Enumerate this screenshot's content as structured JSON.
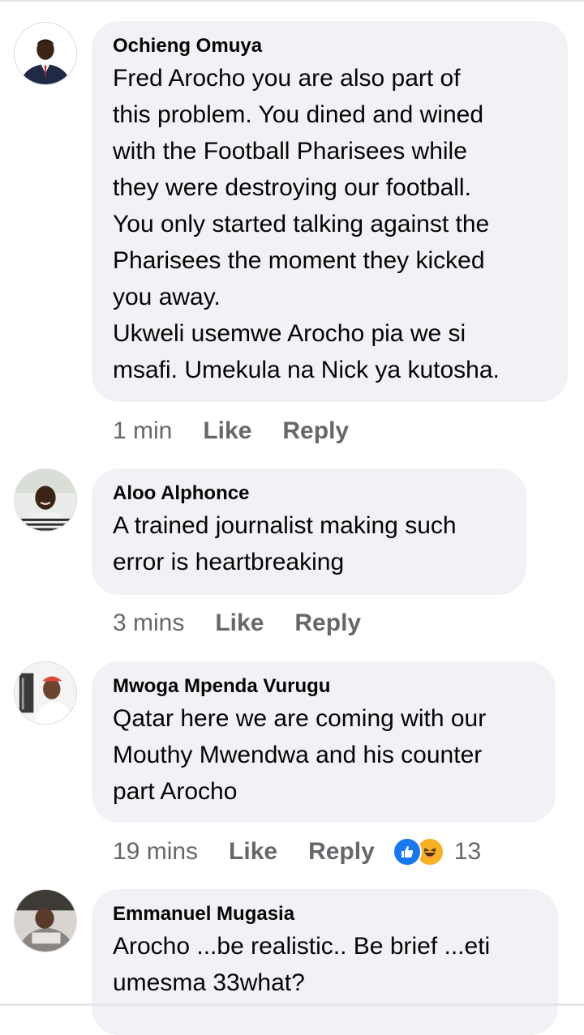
{
  "comments": [
    {
      "author": "Ochieng Omuya",
      "text": " Fred Arocho you are also part of\nthis problem. You dined and wined\nwith the Football Pharisees while\nthey were destroying our football.\nYou only started talking against the\nPharisees the moment they kicked\nyou away.\nUkweli usemwe Arocho pia we si\nmsafi. Umekula na Nick ya kutosha.",
      "time": "1 min",
      "like_label": "Like",
      "reply_label": "Reply"
    },
    {
      "author": "Aloo Alphonce",
      "text": "A trained journalist making such\nerror is heartbreaking",
      "time": "3 mins",
      "like_label": "Like",
      "reply_label": "Reply"
    },
    {
      "author": "Mwoga Mpenda Vurugu",
      "text": "Qatar here we are coming with our\nMouthy Mwendwa and his counter\npart Arocho",
      "time": "19 mins",
      "like_label": "Like",
      "reply_label": "Reply",
      "reaction_count": "13",
      "reactions": [
        "like-reaction-icon",
        "haha-reaction-icon"
      ]
    },
    {
      "author": "Emmanuel Mugasia",
      "text": "Arocho ...be realistic.. Be brief ...eti\numesma 33what?"
    }
  ],
  "colors": {
    "bubble": "#f0f2f5",
    "meta_text": "#65676b",
    "like_blue": "#1877f2",
    "haha_yellow": "#f7b125"
  }
}
